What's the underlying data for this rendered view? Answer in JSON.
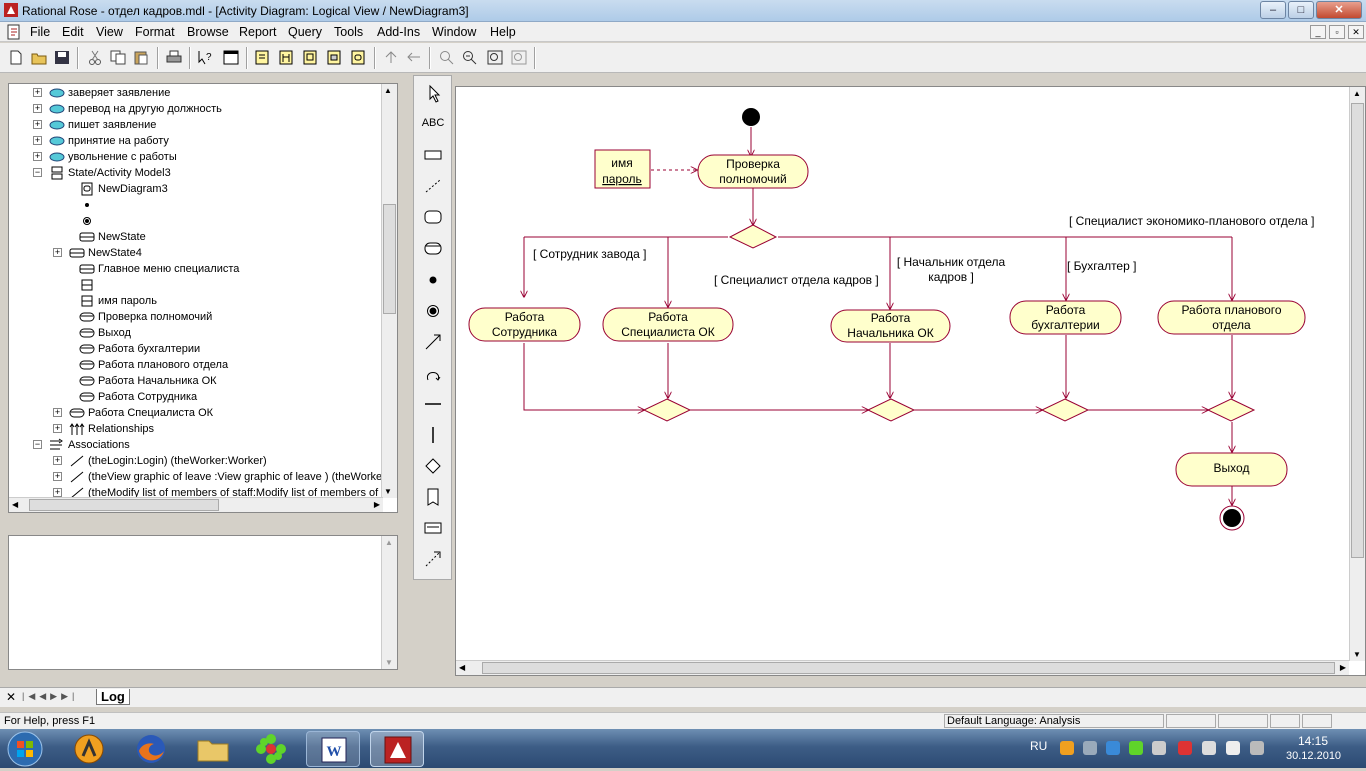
{
  "window": {
    "title": "Rational Rose - отдел кадров.mdl - [Activity Diagram: Logical View / NewDiagram3]",
    "minimize": "–",
    "maximize": "□",
    "close": "✕"
  },
  "menu": [
    "File",
    "Edit",
    "View",
    "Format",
    "Browse",
    "Report",
    "Query",
    "Tools",
    "Add-Ins",
    "Window",
    "Help"
  ],
  "mdi_buttons": [
    "_",
    "▫",
    "✕"
  ],
  "browser": {
    "items": [
      {
        "label": "заверяет заявление",
        "icon": "usecase-icon"
      },
      {
        "label": "перевод на другую должность",
        "icon": "usecase-icon"
      },
      {
        "label": "пишет заявление",
        "icon": "usecase-icon"
      },
      {
        "label": "принятие на работу",
        "icon": "usecase-icon"
      },
      {
        "label": "увольнение с работы",
        "icon": "usecase-icon"
      },
      {
        "label": "State/Activity Model3",
        "icon": "state-model-icon"
      },
      {
        "label": "NewDiagram3",
        "icon": "diagram-icon"
      },
      {
        "label": "",
        "icon": "start-state-icon"
      },
      {
        "label": "",
        "icon": "end-state-icon"
      },
      {
        "label": "NewState",
        "icon": "state-icon"
      },
      {
        "label": "NewState4",
        "icon": "state-icon"
      },
      {
        "label": "Главное меню специалиста",
        "icon": "state-icon"
      },
      {
        "label": "",
        "icon": "object-icon"
      },
      {
        "label": "имя пароль",
        "icon": "object-icon"
      },
      {
        "label": "Проверка полномочий",
        "icon": "activity-icon"
      },
      {
        "label": "Выход",
        "icon": "activity-icon"
      },
      {
        "label": "Работа  бухгалтерии",
        "icon": "activity-icon"
      },
      {
        "label": "Работа  планового отдела",
        "icon": "activity-icon"
      },
      {
        "label": "Работа Начальника ОК",
        "icon": "activity-icon"
      },
      {
        "label": "Работа Сотрудника",
        "icon": "activity-icon"
      },
      {
        "label": "Работа Специалиста ОК",
        "icon": "activity-icon"
      },
      {
        "label": "Relationships",
        "icon": "relationships-icon"
      },
      {
        "label": "Associations",
        "icon": "associations-icon"
      },
      {
        "label": "(theLogin:Login) (theWorker:Worker)",
        "icon": "association-icon"
      },
      {
        "label": "(theView graphic of leave :View graphic of leave ) (theWorker:",
        "icon": "association-icon"
      },
      {
        "label": "(theModify list of members of staff:Modify list of members of sta",
        "icon": "association-icon"
      }
    ]
  },
  "palette": {
    "text_tool": "ABC"
  },
  "diagram": {
    "object_name": "имя",
    "object_attr": "пароль",
    "check": "Проверка полномочий",
    "guard_worker": "[ Сотрудник завода ]",
    "guard_ok": "[ Специалист отдела кадров ]",
    "guard_head": "[ Начальник отдела кадров ]",
    "guard_acc": "[ Бухгалтер ]",
    "guard_plan": "[ Специалист экономико-планового отдела ]",
    "act_worker": "Работа Сотрудника",
    "act_ok": "Работа Специалиста ОК",
    "act_head": "Работа Начальника ОК",
    "act_acc": "Работа бухгалтерии",
    "act_plan": "Работа  планового отдела",
    "exit": "Выход"
  },
  "logtab": "Log",
  "status": {
    "help": "For Help, press F1",
    "language": "Default Language: Analysis"
  },
  "taskbar": {
    "lang": "RU",
    "time": "14:15",
    "date": "30.12.2010"
  },
  "colors": {
    "activity_fill": "#ffffcc",
    "activity_border": "#990033",
    "line": "#990033"
  }
}
